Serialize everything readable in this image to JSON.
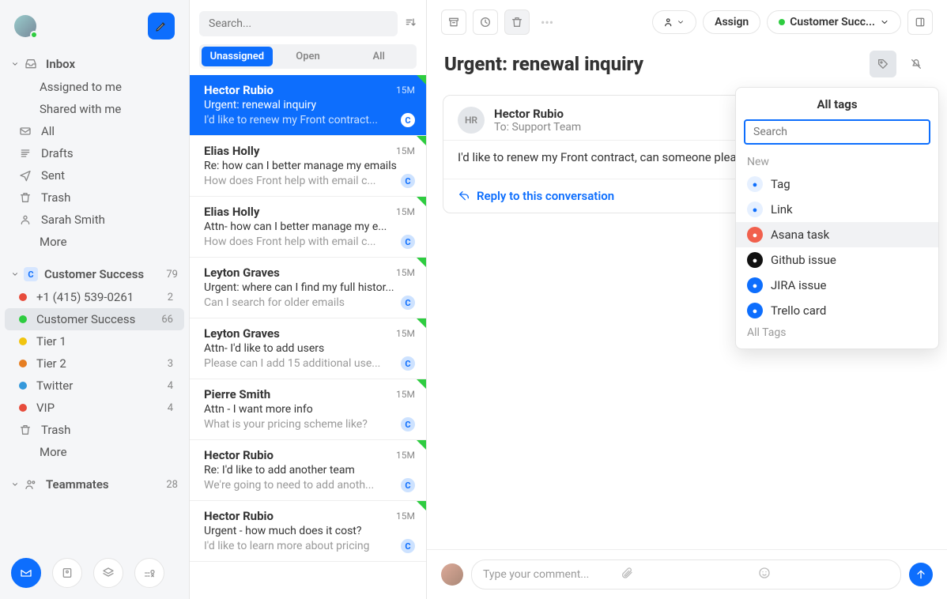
{
  "sidebar": {
    "inbox": {
      "label": "Inbox",
      "items": [
        {
          "label": "Assigned to me"
        },
        {
          "label": "Shared with me"
        }
      ],
      "fixed": [
        {
          "icon": "mail",
          "label": "All"
        },
        {
          "icon": "drafts",
          "label": "Drafts"
        },
        {
          "icon": "sent",
          "label": "Sent"
        },
        {
          "icon": "trash",
          "label": "Trash"
        },
        {
          "icon": "user",
          "label": "Sarah Smith"
        },
        {
          "icon": "",
          "label": "More"
        }
      ]
    },
    "cs": {
      "label": "Customer Success",
      "count": "79",
      "items": [
        {
          "color": "#e74c3c",
          "label": "+1 (415) 539-0261",
          "count": "2"
        },
        {
          "color": "#2ecc40",
          "label": "Customer Success",
          "count": "66",
          "active": true
        },
        {
          "color": "#f1c40f",
          "label": "Tier 1",
          "count": ""
        },
        {
          "color": "#e67e22",
          "label": "Tier 2",
          "count": "3"
        },
        {
          "color": "#3498db",
          "label": "Twitter",
          "count": "4"
        },
        {
          "color": "#e74c3c",
          "label": "VIP",
          "count": "4"
        }
      ],
      "trash": "Trash",
      "more": "More"
    },
    "teammates": {
      "label": "Teammates",
      "count": "28"
    }
  },
  "list": {
    "search_placeholder": "Search...",
    "tabs": [
      {
        "label": "Unassigned",
        "active": true
      },
      {
        "label": "Open"
      },
      {
        "label": "All"
      }
    ],
    "items": [
      {
        "from": "Hector Rubio",
        "time": "15M",
        "subject": "Urgent: renewal inquiry",
        "preview": "I'd like to renew my Front contract...",
        "badge": "C",
        "selected": true
      },
      {
        "from": "Elias Holly",
        "time": "15M",
        "subject": "Re: how can I better manage my emails",
        "preview": "How does Front help with email c...",
        "badge": "C"
      },
      {
        "from": "Elias Holly",
        "time": "15M",
        "subject": "Attn- how can I better manage my e...",
        "preview": "How does Front help with email c...",
        "badge": "C"
      },
      {
        "from": "Leyton Graves",
        "time": "15M",
        "subject": "Urgent: where can I find my full histor...",
        "preview": "Can I search for older emails",
        "badge": "C"
      },
      {
        "from": "Leyton Graves",
        "time": "15M",
        "subject": "Attn- I'd like to add users",
        "preview": "Please can I add 15 additional use...",
        "badge": "C"
      },
      {
        "from": "Pierre Smith",
        "time": "15M",
        "subject": "Attn - I want more info",
        "preview": "What is your pricing scheme like?",
        "badge": "C"
      },
      {
        "from": "Hector Rubio",
        "time": "15M",
        "subject": "Re: I'd like to add another team",
        "preview": "We're going to need to add anoth...",
        "badge": "C"
      },
      {
        "from": "Hector Rubio",
        "time": "15M",
        "subject": "Urgent - how much does it cost?",
        "preview": "I'd like to learn more about pricing",
        "badge": "C"
      }
    ]
  },
  "content": {
    "toolbar": {
      "assign": "Assign",
      "team": "Customer Succ..."
    },
    "title": "Urgent: renewal inquiry",
    "msg": {
      "initials": "HR",
      "from": "Hector Rubio",
      "to_label": "To:",
      "to": "Support Team",
      "body": "I'd like to renew my Front contract, can someone please",
      "reply": "Reply to this conversation"
    }
  },
  "dropdown": {
    "title": "All tags",
    "search_placeholder": "Search",
    "section_new": "New",
    "items": [
      {
        "label": "Tag",
        "bg": "#e6f0ff",
        "fg": "#0d6efd"
      },
      {
        "label": "Link",
        "bg": "#e6f0ff",
        "fg": "#0d6efd"
      },
      {
        "label": "Asana task",
        "bg": "#f1604d",
        "fg": "#fff",
        "hov": true
      },
      {
        "label": "Github issue",
        "bg": "#111",
        "fg": "#fff"
      },
      {
        "label": "JIRA issue",
        "bg": "#0d6efd",
        "fg": "#fff"
      },
      {
        "label": "Trello card",
        "bg": "#0d6efd",
        "fg": "#fff"
      }
    ],
    "all_tags": "All Tags"
  },
  "composer": {
    "placeholder": "Type your comment..."
  }
}
